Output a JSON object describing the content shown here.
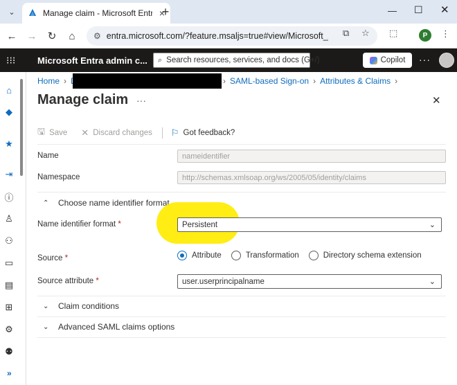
{
  "browser": {
    "tab_title": "Manage claim - Microsoft Entra admin center",
    "url": "entra.microsoft.com/?feature.msaljs=true#view/Microsoft_AAD_I..."
  },
  "portal": {
    "title": "Microsoft Entra admin c...",
    "search_placeholder": "Search resources, services, and docs (G+/)",
    "copilot_label": "Copilot"
  },
  "breadcrumb": {
    "home": "Home",
    "partial": "D",
    "saml": "SAML-based Sign-on",
    "attributes": "Attributes & Claims"
  },
  "page": {
    "title": "Manage claim",
    "more": "···"
  },
  "toolbar": {
    "save_label": "Save",
    "discard_label": "Discard changes",
    "feedback_label": "Got feedback?"
  },
  "form": {
    "name_label": "Name",
    "name_value": "nameidentifier",
    "namespace_label": "Namespace",
    "namespace_value": "http://schemas.xmlsoap.org/ws/2005/05/identity/claims",
    "format_section": "Choose name identifier format",
    "format_label": "Name identifier format",
    "format_value": "Persistent",
    "source_label": "Source",
    "source_options": [
      "Attribute",
      "Transformation",
      "Directory schema extension"
    ],
    "source_selected": "Attribute",
    "source_attr_label": "Source attribute",
    "source_attr_value": "user.userprincipalname",
    "required_mark": "*",
    "claim_conditions": "Claim conditions",
    "advanced_options": "Advanced SAML claims options"
  },
  "colors": {
    "accent": "#0f6cbd",
    "header_bg": "#1b1a19",
    "highlight": "#ffeb00"
  }
}
